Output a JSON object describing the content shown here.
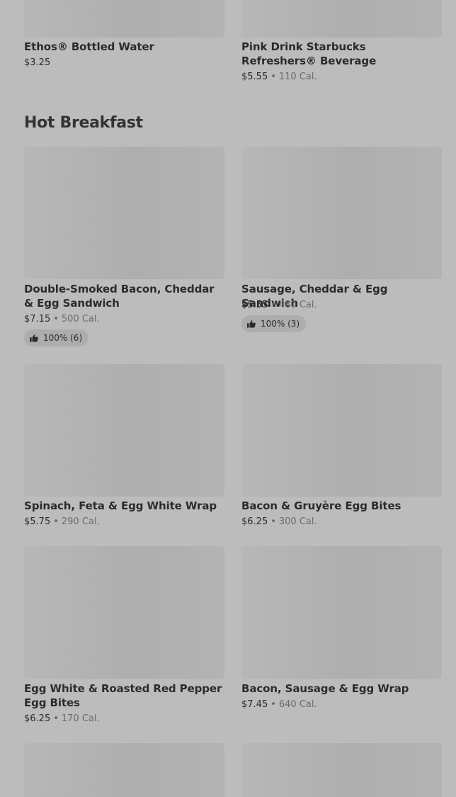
{
  "top_items": [
    {
      "name": "Ethos® Bottled Water",
      "price": "$3.25",
      "calories": ""
    },
    {
      "name": "Pink Drink Starbucks Refreshers® Beverage",
      "price": "$5.55",
      "calories": "110 Cal."
    }
  ],
  "section": {
    "title": "Hot Breakfast",
    "items": [
      {
        "name": "Double-Smoked Bacon, Cheddar & Egg Sandwich",
        "price": "$7.15",
        "calories": "500 Cal.",
        "rating": "100% (6)"
      },
      {
        "name": "Sausage, Cheddar & Egg Sandwich",
        "price": "$5.55",
        "calories": "480 Cal.",
        "rating": "100% (3)"
      },
      {
        "name": "Spinach, Feta & Egg White Wrap",
        "price": "$5.75",
        "calories": "290 Cal."
      },
      {
        "name": "Bacon & Gruyère Egg Bites",
        "price": "$6.25",
        "calories": "300 Cal."
      },
      {
        "name": "Egg White & Roasted Red Pepper Egg Bites",
        "price": "$6.25",
        "calories": "170 Cal."
      },
      {
        "name": "Bacon, Sausage & Egg Wrap",
        "price": "$7.45",
        "calories": "640 Cal."
      }
    ]
  },
  "meta_separator": "•",
  "icons": {
    "rating": "thumbs-up-icon"
  }
}
